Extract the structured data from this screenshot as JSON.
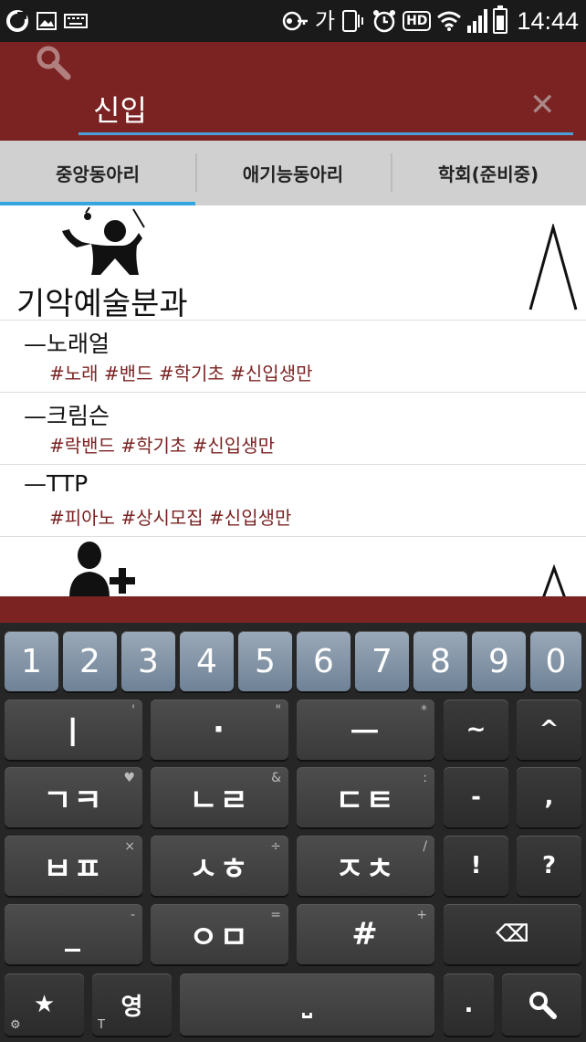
{
  "status_bar": {
    "left_icons": [
      "carrier-icon",
      "image-icon",
      "keyboard-icon"
    ],
    "right_icons": [
      "key-icon",
      "ime-ga-icon",
      "vibrate-icon",
      "alarm-icon",
      "hd-icon",
      "wifi-icon",
      "signal-icon",
      "battery-icon"
    ],
    "ime_label": "가",
    "hd_label": "HD",
    "time": "14:44"
  },
  "search": {
    "value": "신입",
    "clear_symbol": "✕"
  },
  "tabs": [
    {
      "label": "중앙동아리",
      "active": true
    },
    {
      "label": "애기능동아리",
      "active": false
    },
    {
      "label": "학회(준비중)",
      "active": false
    }
  ],
  "groups": [
    {
      "title": "기악예술분과",
      "icon": "conductor-icon",
      "items": [
        {
          "name": "—노래얼",
          "tags": "#노래 #밴드 #학기초 #신입생만"
        },
        {
          "name": "—크림슨",
          "tags": "#락밴드 #학기초 #신입생만"
        },
        {
          "name": "—TTP",
          "tags": "#피아노 #상시모집 #신입생만"
        }
      ]
    },
    {
      "title": "",
      "icon": "add-person-icon",
      "items": []
    }
  ],
  "keyboard": {
    "numbers": [
      "1",
      "2",
      "3",
      "4",
      "5",
      "6",
      "7",
      "8",
      "9",
      "0"
    ],
    "rows": [
      [
        {
          "label": "ㅣ",
          "sub": "'"
        },
        {
          "label": "·",
          "sub": "\""
        },
        {
          "label": "ㅡ",
          "sub": "*"
        },
        {
          "label": "~",
          "sub": ""
        },
        {
          "label": "^",
          "sub": ""
        }
      ],
      [
        {
          "label": "ㄱㅋ",
          "sub": "♥"
        },
        {
          "label": "ㄴㄹ",
          "sub": "&"
        },
        {
          "label": "ㄷㅌ",
          "sub": ":"
        },
        {
          "label": "-",
          "sub": ""
        },
        {
          "label": ",",
          "sub": ""
        }
      ],
      [
        {
          "label": "ㅂㅍ",
          "sub": "×"
        },
        {
          "label": "ㅅㅎ",
          "sub": "÷"
        },
        {
          "label": "ㅈㅊ",
          "sub": "/"
        },
        {
          "label": "!",
          "sub": ""
        },
        {
          "label": "?",
          "sub": ""
        }
      ],
      [
        {
          "label": "_",
          "sub": "-"
        },
        {
          "label": "ㅇㅁ",
          "sub": "="
        },
        {
          "label": "#",
          "sub": "+"
        },
        {
          "label": "⌫",
          "sub": ""
        }
      ]
    ],
    "bottom": {
      "star": "★",
      "lang": "영",
      "lang_corner": "T",
      "space": "⎵",
      "dot": ".",
      "search": "🔍"
    }
  }
}
